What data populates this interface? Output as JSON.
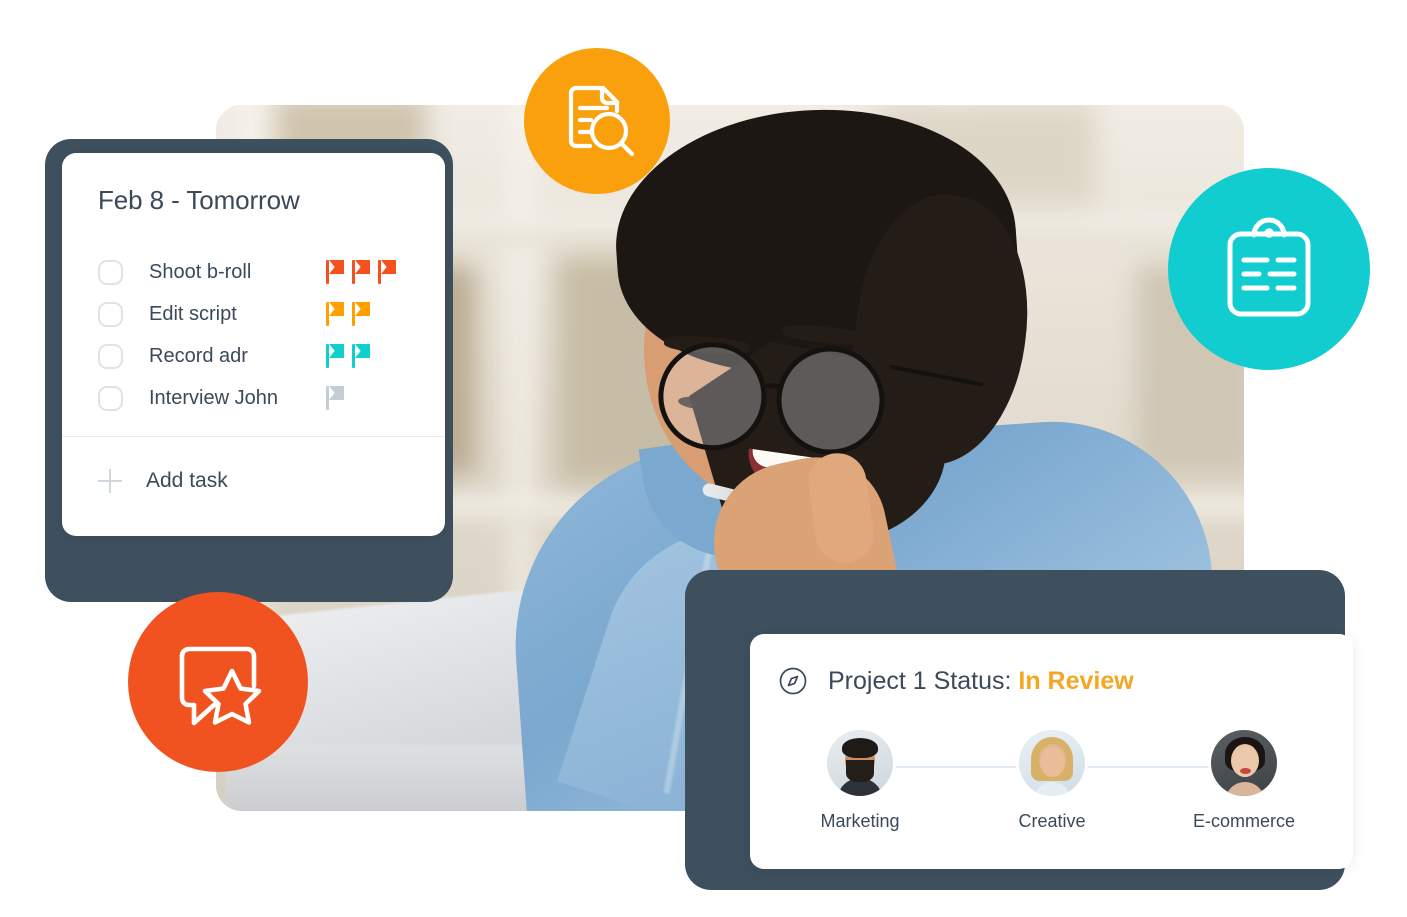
{
  "task_card": {
    "title": "Feb 8 - Tomorrow",
    "tasks": [
      {
        "label": "Shoot b-roll",
        "flag_count": 3,
        "flag_color": "#f4511e"
      },
      {
        "label": "Edit script",
        "flag_count": 2,
        "flag_color": "#ffa000"
      },
      {
        "label": "Record adr",
        "flag_count": 2,
        "flag_color": "#0fcfcf"
      },
      {
        "label": "Interview John",
        "flag_count": 1,
        "flag_color": "#c3cdd6"
      }
    ],
    "add_task_label": "Add task"
  },
  "status_card": {
    "prefix": "Project 1 Status:",
    "status_value": "In Review",
    "status_color": "#f5a623",
    "people": [
      {
        "name": "Marketing"
      },
      {
        "name": "Creative"
      },
      {
        "name": "E-commerce"
      }
    ]
  },
  "badges": {
    "doc_search": {
      "icon": "document-search-icon",
      "color": "#f9a00c"
    },
    "clipboard": {
      "icon": "clipboard-icon",
      "color": "#11cdd0"
    },
    "chat_star": {
      "icon": "chat-star-icon",
      "color": "#f0531f"
    }
  },
  "theme": {
    "card_backing": "#3e4f5e",
    "text": "#3b4a5a"
  }
}
